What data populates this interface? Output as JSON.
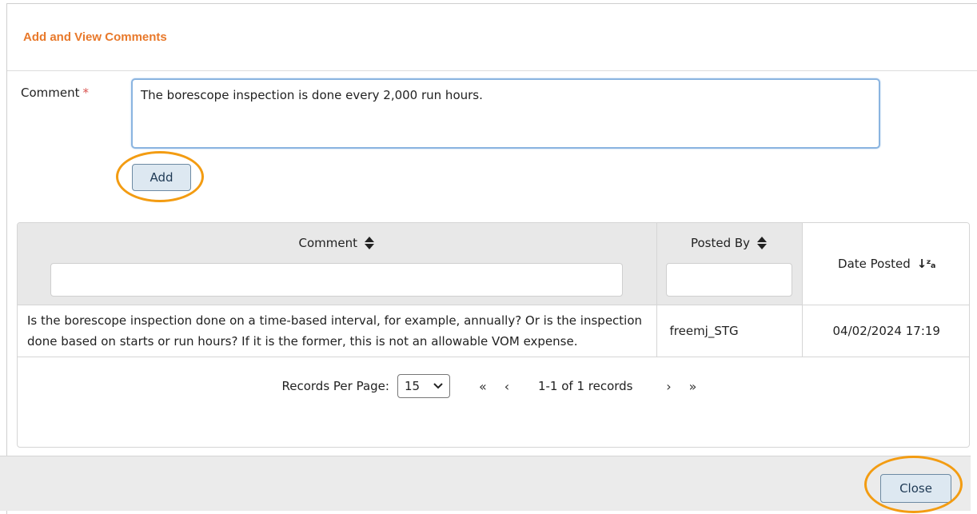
{
  "dialog": {
    "title": "Add and View Comments"
  },
  "form": {
    "comment_label": "Comment",
    "required_mark": "*",
    "comment_value": "The borescope inspection is done every 2,000 run hours.",
    "add_label": "Add"
  },
  "grid": {
    "columns": [
      {
        "label": "Comment",
        "sort": "sort-icon"
      },
      {
        "label": "Posted By",
        "sort": "sort-icon"
      },
      {
        "label": "Date Posted",
        "sort": "sort-descending-za-icon"
      }
    ],
    "sort_za_glyph": "↓ᶻₐ",
    "rows": [
      {
        "comment": "Is the borescope inspection done on a time-based interval, for example, annually? Or is the inspection done based on starts or run hours? If it is the former, this is not an allowable VOM expense.",
        "posted_by": "freemj_STG",
        "date_posted": "04/02/2024 17:19"
      }
    ]
  },
  "pager": {
    "records_per_page_label": "Records Per Page:",
    "records_per_page_value": "15",
    "first_glyph": "«",
    "prev_glyph": "‹",
    "info": "1-1 of 1 records",
    "next_glyph": "›",
    "last_glyph": "»"
  },
  "footer": {
    "close_label": "Close"
  },
  "colors": {
    "title": "#e8792b",
    "highlight": "#f39c12",
    "button_bg": "#dde8f1"
  }
}
